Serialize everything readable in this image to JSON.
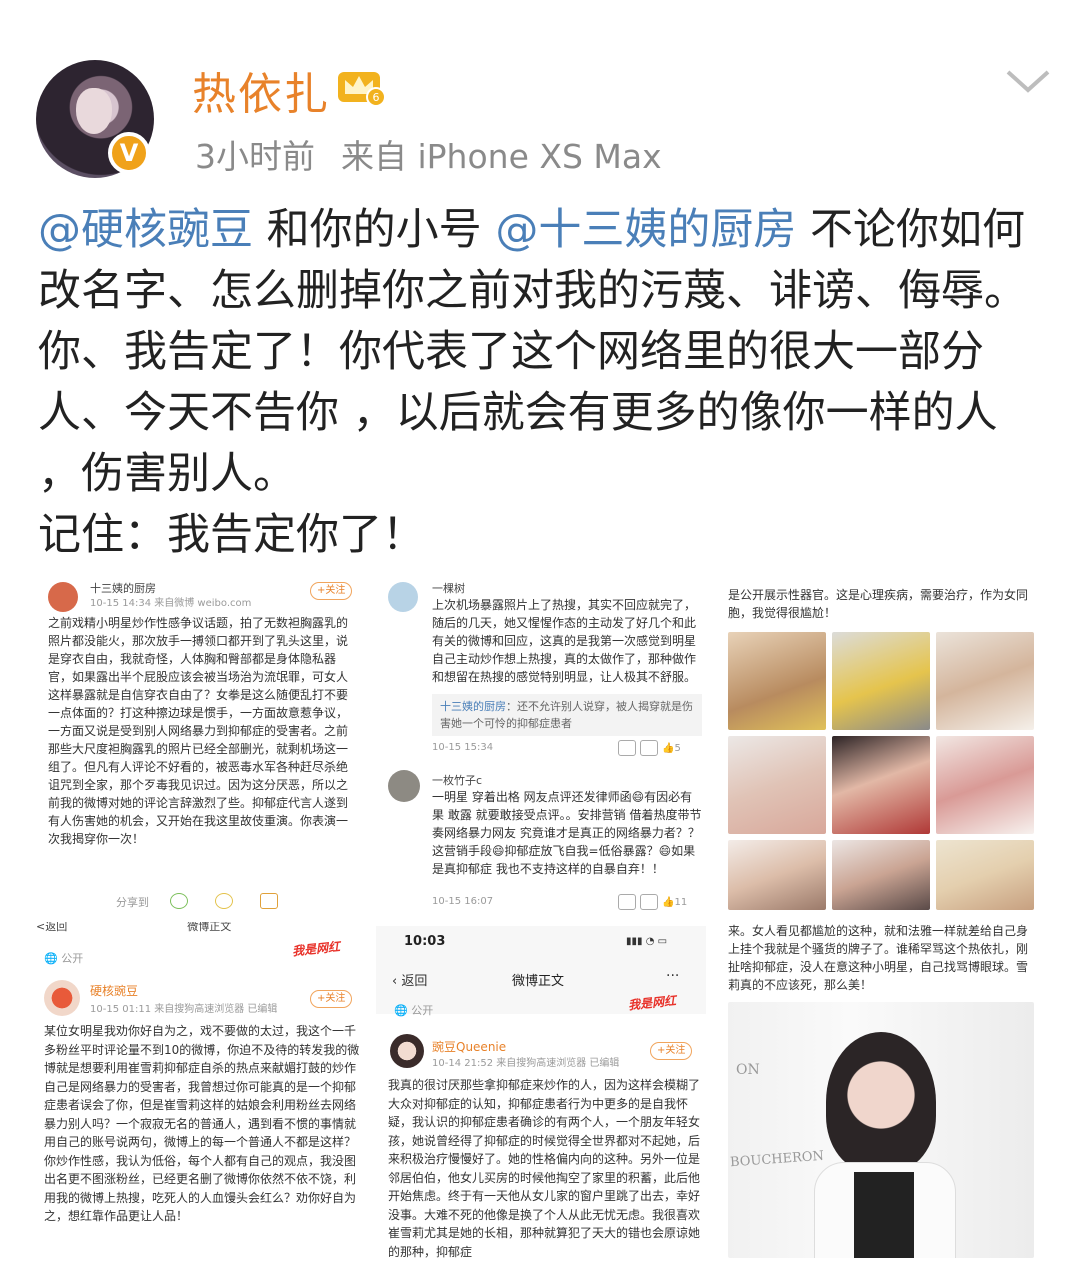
{
  "header": {
    "username": "热依扎",
    "time": "3小时前",
    "source": "来自 iPhone XS Max",
    "verified_badge": "V",
    "vip_level": "6"
  },
  "post": {
    "mention1": "@硬核豌豆",
    "text1": " 和你的小号 ",
    "mention2": "@十三姨的厨房",
    "text2": " 不论你如何改名字、怎么删掉你之前对我的污蔑、诽谤、侮辱。你、我告定了！你代表了这个网络里的很大一部分人、今天不告你 ，以后就会有更多的像你一样的人 ，伤害别人。",
    "line2": "记住：我告定你了！"
  },
  "screens": {
    "a": {
      "name_partial": "十三姨的厨房",
      "time": "10-15 14:34",
      "source": "来自微博 weibo.com",
      "follow": "+关注",
      "body": "之前戏精小明星炒作性感争议话题，拍了无数袒胸露乳的照片都没能火，那次放手一搏领口都开到了乳头这里，说是穿衣自由，我就奇怪，人体胸和臀部都是身体隐私器官，如果露出半个屁股应该会被当场治为流氓罪，可女人这样暴露就是自信穿衣自由了？女拳是这么随便乱打不要一点体面的？打这种擦边球是惯手，一方面故意惹争议，一方面又说是受到别人网络暴力到抑郁症的受害者。之前那些大尺度袒胸露乳的照片已经全部删光，就剩机场这一组了。但凡有人评论不好看的，被恶毒水军各种赶尽杀绝诅咒到全家，那个歹毒我见识过。因为这分厌恶，所以之前我的微博对她的评论言辞激烈了些。抑郁症代言人遂到有人伤害她的机会，又开始在我这里故伎重演。你表演一次我揭穿你一次！",
      "share": "分享到"
    },
    "b": {
      "name": "一棵树",
      "body": "上次机场暴露照片上了热搜，其实不回应就完了，随后的几天，她又惺惺作态的主动发了好几个和此有关的微博和回应，这真的是我第一次感觉到明星自己主动炒作想上热搜，真的太做作了，那种做作和想留在热搜的感觉特别明显，让人极其不舒服。",
      "quote_at": "十三姨的厨房",
      "quote": "：还不允许别人说穿，被人揭穿就是伤害她一个可怜的抑郁症患者",
      "time": "10-15 15:34",
      "likes": "5",
      "name2": "一枚竹子c",
      "body2": "一明星 穿着出格 网友点评还发律师函😄有因必有果 敢露 就要敢接受点评。。安排营销 借着热度带节奏网络暴力网友 究竟谁才是真正的网络暴力者？？这营销手段😄抑郁症放飞自我=低俗暴露？😄如果是真抑郁症 我也不支持这样的自暴自弃！！",
      "time2": "10-15 16:07",
      "likes2": "11"
    },
    "c": {
      "top_text": "是公开展示性器官。这是心理疾病，需要治疗，作为女同胞，我觉得很尴尬！",
      "bottom_text": "来。女人看见都尴尬的这种，就和法雅一样就差给自己身上挂个我就是个骚货的牌子了。谁稀罕骂这个热依扎，刚扯啥抑郁症，没人在意这种小明星，自己找骂博眼球。雪莉真的不应该死，那么美！",
      "brand1": "BOUCHERON",
      "brand2": "ON"
    },
    "d": {
      "tab_back": "<返回",
      "tab_title": "微博正文",
      "public": "公开",
      "stamp": "我是网红",
      "name": "硬核豌豆",
      "time": "10-15 01:11",
      "source": "来自搜狗高速浏览器 已编辑",
      "follow": "+关注",
      "body": "某位女明星我劝你好自为之，戏不要做的太过，我这个一千多粉丝平时评论量不到10的微博，你迫不及待的转发我的微博就是想要利用崔雪莉抑郁症自杀的热点来献媚打鼓的炒作自己是网络暴力的受害者，我曾想过你可能真的是一个抑郁症患者误会了你，但是崔雪莉这样的姑娘会利用粉丝去网络暴力别人吗？一个寂寂无名的普通人，遇到看不惯的事情就用自己的账号说两句，微博上的每一个普通人不都是这样？你炒作性感，我认为低俗，每个人都有自己的观点，我没图出名更不图涨粉丝，已经更名删了微博你依然不依不饶，利用我的微博上热搜，吃死人的人血馒头会红么？劝你好自为之，想红靠作品更让人品！"
    },
    "e": {
      "clock": "10:03",
      "back": "返回",
      "title": "微博正文",
      "more": "···",
      "public": "公开",
      "stamp": "我是网红",
      "name": "豌豆Queenie",
      "time": "10-14 21:52",
      "source": "来自搜狗高速浏览器 已编辑",
      "follow": "+关注",
      "body": "我真的很讨厌那些拿抑郁症来炒作的人，因为这样会模糊了大众对抑郁症的认知，抑郁症患者行为中更多的是自我怀疑，我认识的抑郁症患者确诊的有两个人，一个朋友年轻女孩，她说曾经得了抑郁症的时候觉得全世界都对不起她，后来积极治疗慢慢好了。她的性格偏内向的这种。另外一位是邻居伯伯，他女儿买房的时候他掏空了家里的积蓄，此后他开始焦虑。终于有一天他从女儿家的窗户里跳了出去，幸好没事。大难不死的他像是换了个人从此无忧无虑。我很喜欢崔雪莉尤其是她的长相，那种就算犯了天大的错也会原谅她的那种，抑郁症"
    }
  }
}
